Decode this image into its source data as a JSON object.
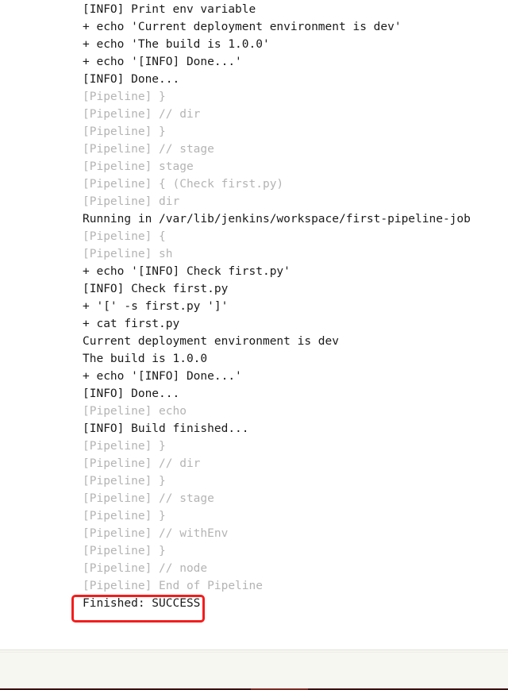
{
  "console": {
    "lines": [
      {
        "text": "[INFO] Print env variable",
        "style": "plain"
      },
      {
        "text": "+ echo 'Current deployment environment is dev'",
        "style": "plain"
      },
      {
        "text": "+ echo 'The build is 1.0.0'",
        "style": "plain"
      },
      {
        "text": "+ echo '[INFO] Done...'",
        "style": "plain"
      },
      {
        "text": "[INFO] Done...",
        "style": "plain"
      },
      {
        "text": "[Pipeline] }",
        "style": "pipeline"
      },
      {
        "text": "[Pipeline] // dir",
        "style": "pipeline"
      },
      {
        "text": "[Pipeline] }",
        "style": "pipeline"
      },
      {
        "text": "[Pipeline] // stage",
        "style": "pipeline"
      },
      {
        "text": "[Pipeline] stage",
        "style": "pipeline"
      },
      {
        "text": "[Pipeline] { (Check first.py)",
        "style": "pipeline"
      },
      {
        "text": "[Pipeline] dir",
        "style": "pipeline"
      },
      {
        "text": "Running in /var/lib/jenkins/workspace/first-pipeline-job",
        "style": "plain"
      },
      {
        "text": "[Pipeline] {",
        "style": "pipeline"
      },
      {
        "text": "[Pipeline] sh",
        "style": "pipeline"
      },
      {
        "text": "+ echo '[INFO] Check first.py'",
        "style": "plain"
      },
      {
        "text": "[INFO] Check first.py",
        "style": "plain"
      },
      {
        "text": "+ '[' -s first.py ']'",
        "style": "plain"
      },
      {
        "text": "+ cat first.py",
        "style": "plain"
      },
      {
        "text": "Current deployment environment is dev",
        "style": "plain"
      },
      {
        "text": "The build is 1.0.0",
        "style": "plain"
      },
      {
        "text": "+ echo '[INFO] Done...'",
        "style": "plain"
      },
      {
        "text": "[INFO] Done...",
        "style": "plain"
      },
      {
        "text": "[Pipeline] echo",
        "style": "pipeline"
      },
      {
        "text": "[INFO] Build finished...",
        "style": "plain"
      },
      {
        "text": "[Pipeline] }",
        "style": "pipeline"
      },
      {
        "text": "[Pipeline] // dir",
        "style": "pipeline"
      },
      {
        "text": "[Pipeline] }",
        "style": "pipeline"
      },
      {
        "text": "[Pipeline] // stage",
        "style": "pipeline"
      },
      {
        "text": "[Pipeline] }",
        "style": "pipeline"
      },
      {
        "text": "[Pipeline] // withEnv",
        "style": "pipeline"
      },
      {
        "text": "[Pipeline] }",
        "style": "pipeline"
      },
      {
        "text": "[Pipeline] // node",
        "style": "pipeline"
      },
      {
        "text": "[Pipeline] End of Pipeline",
        "style": "pipeline"
      },
      {
        "text": "Finished: SUCCESS",
        "style": "plain"
      }
    ]
  },
  "annotation": {
    "highlight_target": "Finished: SUCCESS",
    "highlight_color": "#f41d1d"
  },
  "colors": {
    "page_background": "#ffffff",
    "log_text": "#000000",
    "pipeline_text": "#b4b4b4",
    "footer_background": "#f7f7f2",
    "footer_rule": "#3b1010"
  }
}
